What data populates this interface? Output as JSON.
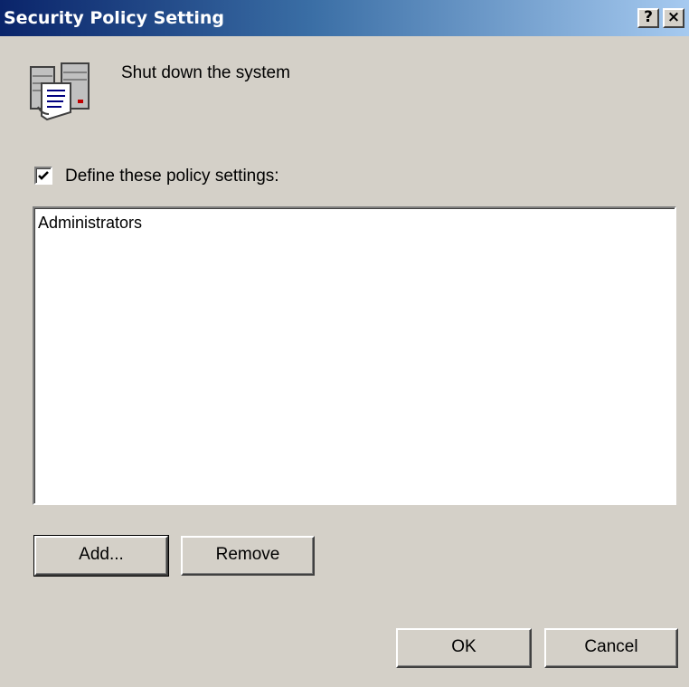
{
  "window": {
    "title": "Security Policy Setting",
    "help_label": "?",
    "close_label": "×"
  },
  "policy": {
    "name": "Shut down the system",
    "icon": "policy-document-icon"
  },
  "define": {
    "label": "Define these policy settings:",
    "checked": true
  },
  "accounts": {
    "items": [
      "Administrators"
    ]
  },
  "buttons": {
    "add": "Add...",
    "remove": "Remove",
    "ok": "OK",
    "cancel": "Cancel"
  },
  "colors": {
    "titlebar_start": "#0a246a",
    "titlebar_end": "#a6caf0",
    "dialog_face": "#d4d0c8"
  }
}
